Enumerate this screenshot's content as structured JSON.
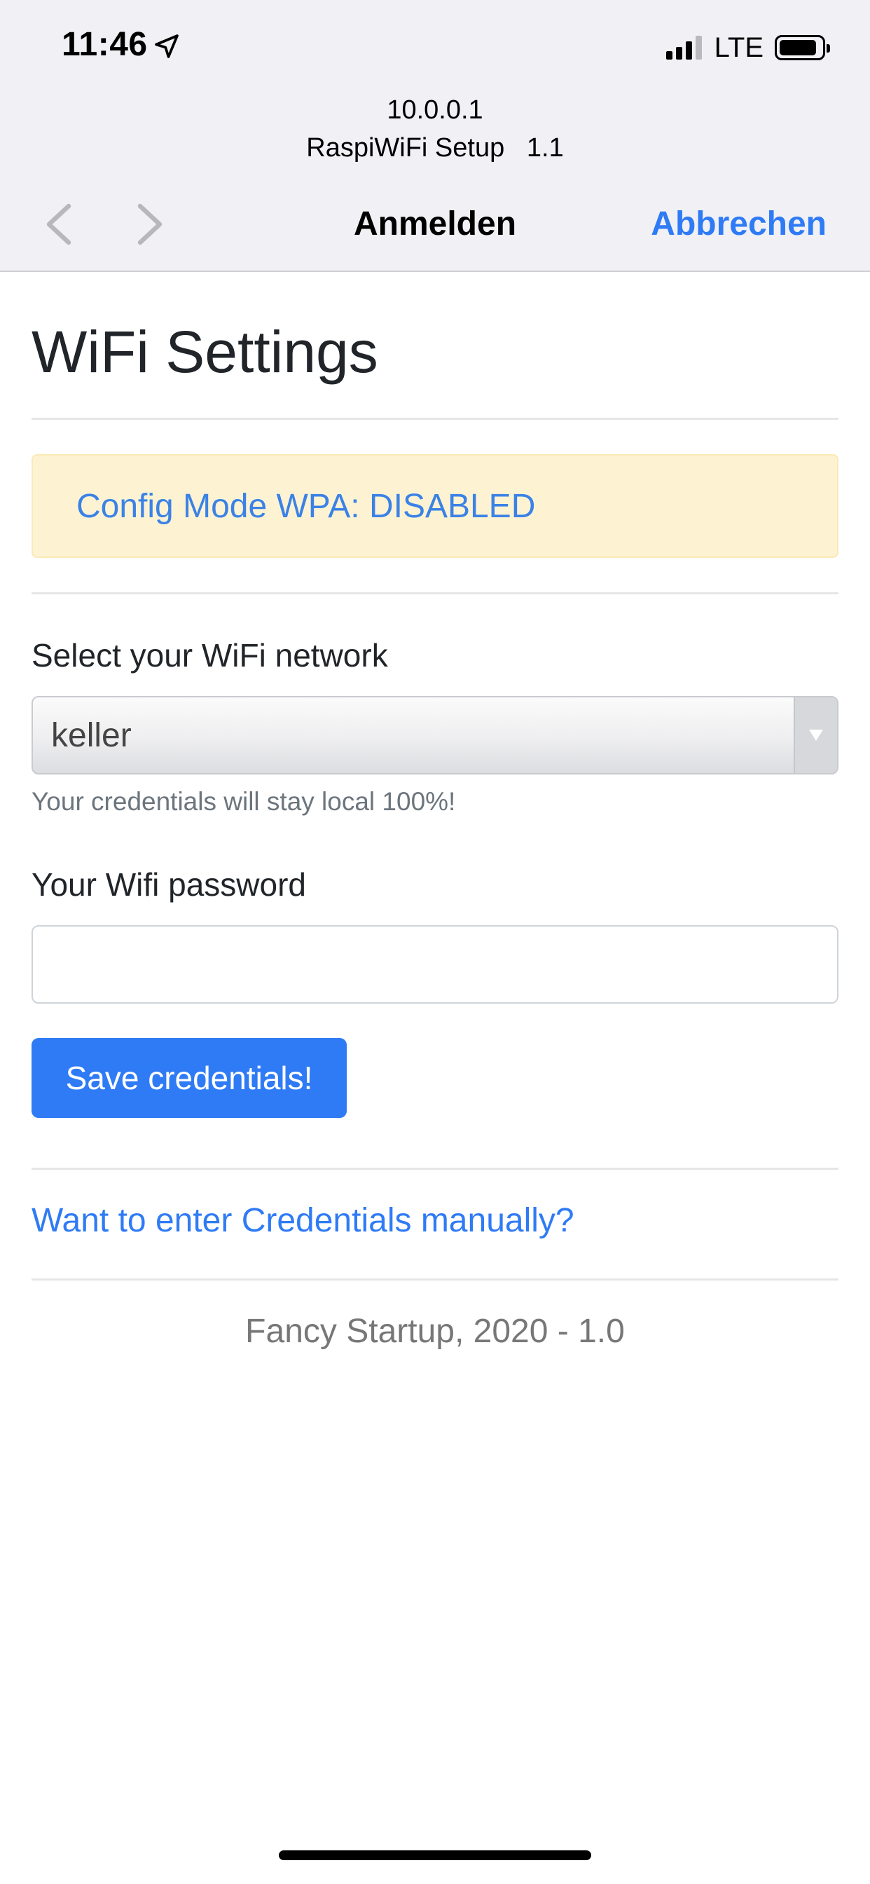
{
  "status_bar": {
    "time": "11:46",
    "location_icon": "location-arrow-icon",
    "network": "LTE",
    "signal_bars_on": 3,
    "signal_bars_total": 4,
    "battery_level": 0.9
  },
  "portal_header": {
    "host": "10.0.0.1",
    "site_title": "RaspiWiFi Setup   1.1",
    "back_icon": "chevron-left-icon",
    "forward_icon": "chevron-right-icon",
    "title": "Anmelden",
    "cancel_label": "Abbrechen"
  },
  "page": {
    "title": "WiFi Settings",
    "alert_text": "Config Mode WPA: DISABLED",
    "network_label": "Select your WiFi network",
    "network_selected": "keller",
    "network_help": "Your credentials will stay local 100%!",
    "password_label": "Your Wifi password",
    "password_value": "",
    "save_label": "Save credentials!",
    "manual_link": "Want to enter Credentials manually?",
    "footer": "Fancy Startup, 2020 - 1.0"
  },
  "colors": {
    "accent": "#2f7bf5",
    "alert_bg": "#fdf3d3",
    "alert_text": "#3b82e6",
    "chrome_bg": "#f0f0f5"
  }
}
